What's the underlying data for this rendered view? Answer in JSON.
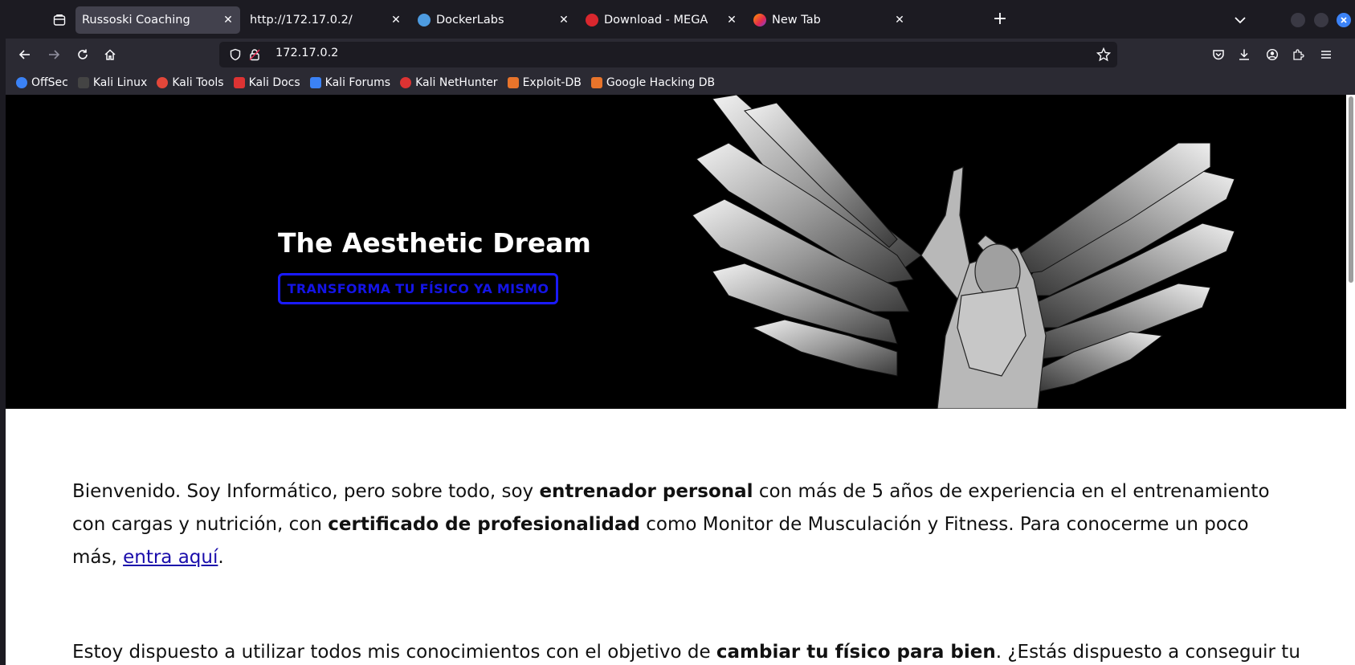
{
  "tabs": [
    {
      "title": "Russoski Coaching",
      "active": true
    },
    {
      "title": "http://172.17.0.2/",
      "active": false
    },
    {
      "title": "DockerLabs",
      "active": false
    },
    {
      "title": "Download - MEGA",
      "active": false
    },
    {
      "title": "New Tab",
      "active": false
    }
  ],
  "newtab_symbol": "+",
  "url": "172.17.0.2",
  "bookmarks": [
    {
      "label": "OffSec",
      "color": "#3b82f6"
    },
    {
      "label": "Kali Linux",
      "color": "#cccccc"
    },
    {
      "label": "Kali Tools",
      "color": "#e2473a"
    },
    {
      "label": "Kali Docs",
      "color": "#d33"
    },
    {
      "label": "Kali Forums",
      "color": "#3b82f6"
    },
    {
      "label": "Kali NetHunter",
      "color": "#d33"
    },
    {
      "label": "Exploit-DB",
      "color": "#e8742b"
    },
    {
      "label": "Google Hacking DB",
      "color": "#e8742b"
    }
  ],
  "hero": {
    "title": "The Aesthetic Dream",
    "cta": "TRANSFORMA TU FÍSICO YA MISMO"
  },
  "intro": {
    "t1": "Bienvenido. Soy Informático, pero sobre todo, soy ",
    "b1": "entrenador personal",
    "t2": " con más de 5 años de experiencia en el entrenamiento con cargas y nutrición, con ",
    "b2": "certificado de profesionalidad",
    "t3": " como Monitor de Musculación y Fitness. Para conocerme un poco más, ",
    "link": "entra aquí",
    "t4": "."
  },
  "second": {
    "t1": "Estoy dispuesto a utilizar todos mis conocimientos con el objetivo de ",
    "b1": "cambiar tu físico para bien",
    "t2": ". ¿Estás dispuesto a conseguir tu"
  },
  "colors": {
    "accent": "#1a1aff",
    "link": "#1a0dab"
  }
}
